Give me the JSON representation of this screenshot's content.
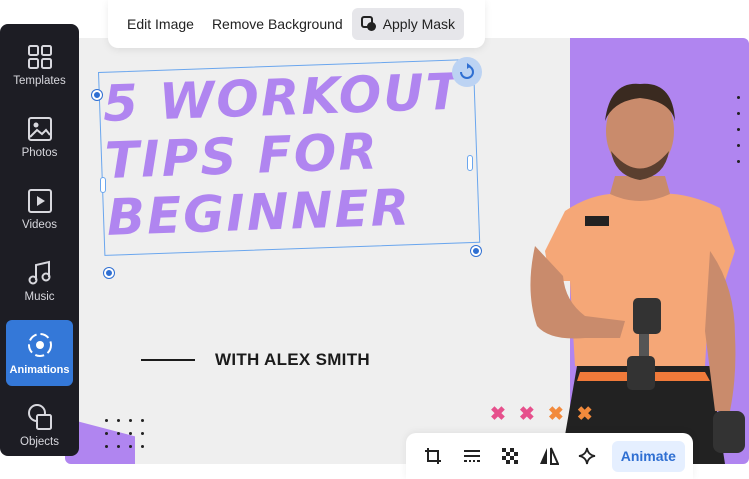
{
  "sidebar": {
    "items": [
      {
        "label": "Templates",
        "icon": "templates-icon",
        "active": false
      },
      {
        "label": "Photos",
        "icon": "photos-icon",
        "active": false
      },
      {
        "label": "Videos",
        "icon": "videos-icon",
        "active": false
      },
      {
        "label": "Music",
        "icon": "music-icon",
        "active": false
      },
      {
        "label": "Animations",
        "icon": "animations-icon",
        "active": true
      },
      {
        "label": "Objects",
        "icon": "objects-icon",
        "active": false
      }
    ]
  },
  "top_toolbar": {
    "edit_image": "Edit Image",
    "remove_background": "Remove Background",
    "apply_mask": "Apply Mask"
  },
  "canvas": {
    "headline_lines": [
      "5 WORKOUT",
      "TIPS FOR",
      "BEGINNER"
    ],
    "byline": "WITH ALEX SMITH",
    "crosses": [
      "✖",
      "✖",
      "✖",
      "✖"
    ]
  },
  "bottom_toolbar": {
    "icons": [
      "crop-icon",
      "lines-icon",
      "checker-icon",
      "flip-icon",
      "sparkle-icon"
    ],
    "animate_label": "Animate"
  },
  "colors": {
    "accent": "#b085f0",
    "primary_blue": "#3478d8",
    "sidebar_bg": "#1d1d24",
    "cross_pink": "#e6508c",
    "cross_orange": "#f28a3c"
  }
}
